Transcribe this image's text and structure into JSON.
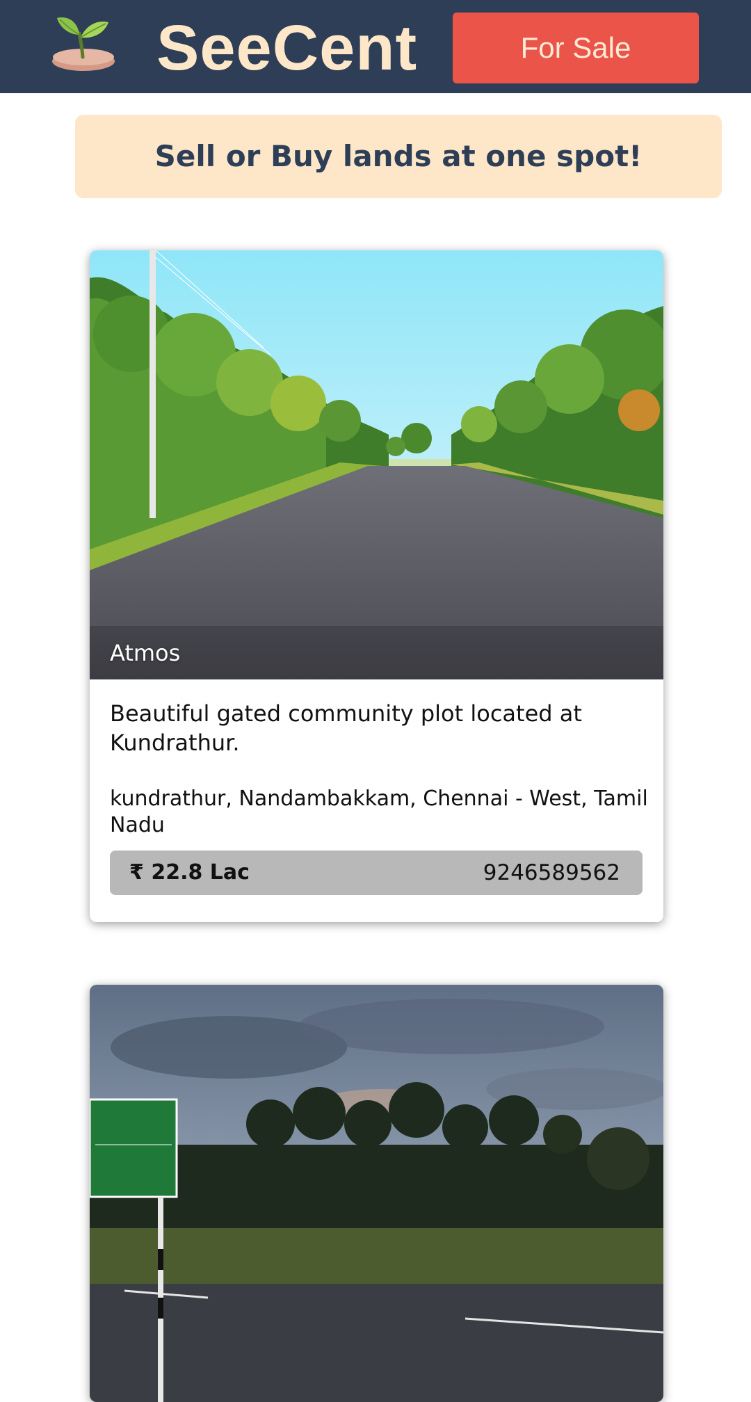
{
  "header": {
    "logo_icon": "sprout-icon",
    "brand_name": "SeeCent",
    "for_sale_label": "For Sale"
  },
  "banner": {
    "text": "Sell or Buy lands at one spot!"
  },
  "listings": [
    {
      "image": "tree-lined-road-photo",
      "image_caption": "Atmos",
      "title": "Beautiful gated community plot located at Kundrathur.",
      "location": "kundrathur, Nandambakkam, Chennai - West, Tamil Nadu",
      "price": "₹ 22.8 Lac",
      "phone": "9246589562"
    },
    {
      "image": "palm-trees-roadside-photo"
    }
  ],
  "colors": {
    "header_bg": "#2d3e56",
    "brand_text": "#fde7c8",
    "for_sale_bg": "#eb5449",
    "banner_bg": "#fde7c8",
    "price_bar_bg": "#b8b8b8"
  }
}
